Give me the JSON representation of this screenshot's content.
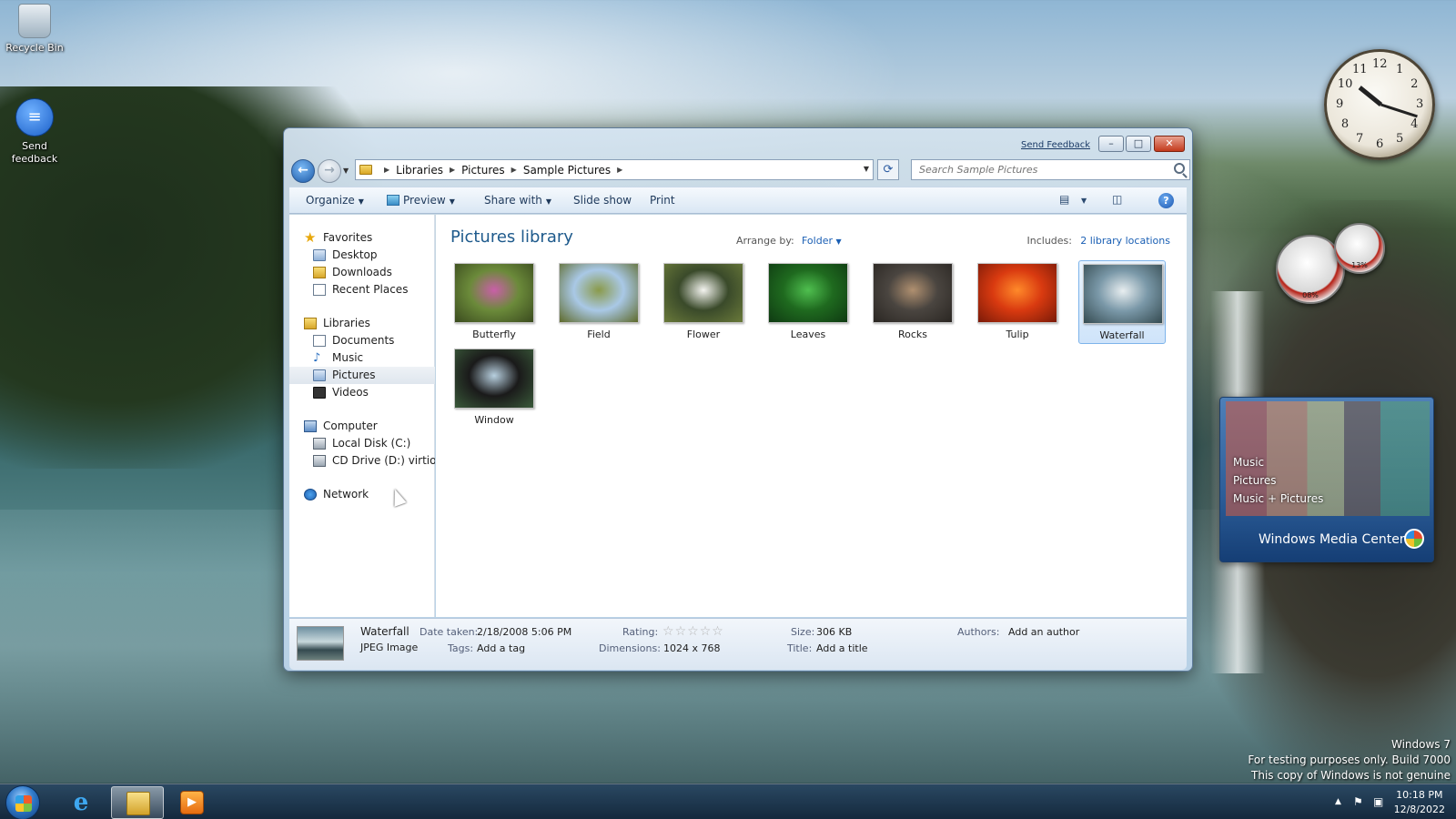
{
  "desktop": {
    "icons": [
      {
        "label": "Recycle Bin"
      },
      {
        "label": "Send feedback"
      }
    ]
  },
  "window": {
    "feedback_link": "Send Feedback",
    "controls": {
      "minimize": "–",
      "maximize": "□",
      "close": "✕"
    },
    "breadcrumb": [
      "Libraries",
      "Pictures",
      "Sample Pictures"
    ],
    "search_placeholder": "Search Sample Pictures",
    "toolbar": {
      "organize": "Organize",
      "preview": "Preview",
      "share_with": "Share with",
      "slide_show": "Slide show",
      "print": "Print"
    },
    "nav": {
      "favorites": {
        "label": "Favorites",
        "items": [
          "Desktop",
          "Downloads",
          "Recent Places"
        ]
      },
      "libraries": {
        "label": "Libraries",
        "items": [
          "Documents",
          "Music",
          "Pictures",
          "Videos"
        ],
        "selected": "Pictures"
      },
      "computer": {
        "label": "Computer",
        "items": [
          "Local Disk (C:)",
          "CD Drive (D:) virtio-w"
        ]
      },
      "network": {
        "label": "Network"
      }
    },
    "content": {
      "title": "Pictures library",
      "arrange_by_label": "Arrange by:",
      "arrange_by_value": "Folder",
      "includes_label": "Includes:",
      "includes_link": "2 library locations",
      "items": [
        {
          "name": "Butterfly",
          "colors": [
            "#6b8a3a",
            "#c95fa8",
            "#3a4a1e"
          ]
        },
        {
          "name": "Field",
          "colors": [
            "#a9c8e6",
            "#8a9a4a",
            "#5e6a2a"
          ]
        },
        {
          "name": "Flower",
          "colors": [
            "#3a4a2a",
            "#f4f4f0",
            "#6a7a3a"
          ]
        },
        {
          "name": "Leaves",
          "colors": [
            "#1f6a1f",
            "#4fbf4f",
            "#0f3a12"
          ]
        },
        {
          "name": "Rocks",
          "colors": [
            "#4a4540",
            "#b09070",
            "#2a2622"
          ]
        },
        {
          "name": "Tulip",
          "colors": [
            "#d93a10",
            "#ff8a2a",
            "#7a1a08"
          ]
        },
        {
          "name": "Waterfall",
          "colors": [
            "#7a98a8",
            "#e8eef0",
            "#344a50"
          ],
          "selected": true
        },
        {
          "name": "Window",
          "colors": [
            "#1a1a1a",
            "#b8d0e0",
            "#3a5a3a"
          ]
        }
      ]
    },
    "details": {
      "name": "Waterfall",
      "type": "JPEG Image",
      "date_taken_label": "Date taken:",
      "date_taken": "2/18/2008 5:06 PM",
      "tags_label": "Tags:",
      "tags": "Add a tag",
      "rating_label": "Rating:",
      "rating": 0,
      "dimensions_label": "Dimensions:",
      "dimensions": "1024 x 768",
      "size_label": "Size:",
      "size": "306 KB",
      "title_label": "Title:",
      "title": "Add a title",
      "authors_label": "Authors:",
      "authors": "Add an author"
    }
  },
  "gadgets": {
    "clock_numbers": [
      "12",
      "1",
      "2",
      "3",
      "4",
      "5",
      "6",
      "7",
      "8",
      "9",
      "10",
      "11"
    ],
    "cpu_meter": {
      "value": "08%"
    },
    "mem_meter": {
      "value": "13%"
    },
    "media_center": {
      "menu": [
        "Music",
        "Pictures",
        "Music + Pictures"
      ],
      "brand": "Windows Media Center"
    }
  },
  "watermark": {
    "line1": "Windows 7",
    "line2": "For testing purposes only. Build 7000",
    "line3": "This copy of Windows is not genuine"
  },
  "taskbar": {
    "time": "10:18 PM",
    "date": "12/8/2022"
  }
}
